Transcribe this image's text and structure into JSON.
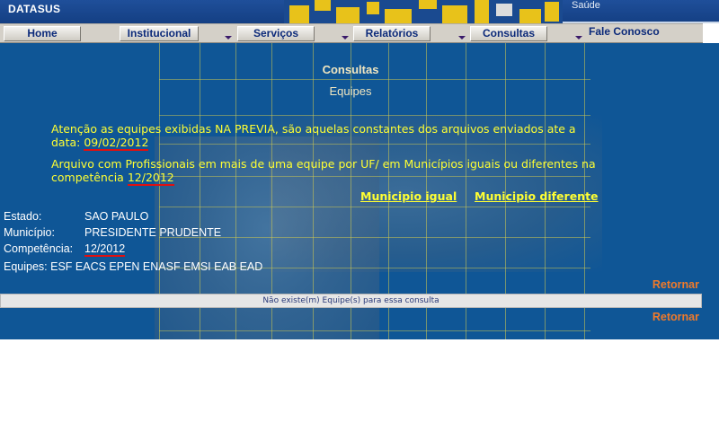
{
  "header": {
    "logo": "DATASUS",
    "ministry": "Saúde"
  },
  "nav": {
    "items": [
      {
        "label": "Home"
      },
      {
        "label": "Institucional"
      },
      {
        "label": "Serviços"
      },
      {
        "label": "Relatórios"
      },
      {
        "label": "Consultas"
      },
      {
        "label": "Fale Conosco"
      }
    ]
  },
  "main": {
    "title": "Consultas",
    "subtitle": "Equipes",
    "notice1_text": "Atenção as equipes exibidas NA PREVIA, são aquelas constantes dos arquivos enviados ate a data:",
    "notice1_date": "09/02/2012",
    "notice2_text": "Arquivo com Profissionais em mais de uma equipe por UF/ em Municípios iguais ou diferentes na competência",
    "notice2_comp": "12/2012",
    "link_igual": "Municipio igual",
    "link_diferente": "Municipio diferente",
    "estado_label": "Estado:",
    "estado_value": "SAO PAULO",
    "municipio_label": "Município:",
    "municipio_value": "PRESIDENTE PRUDENTE",
    "competencia_label": "Competência:",
    "competencia_value": "12/2012",
    "equipes_line": "Equipes: ESF EACS EPEN ENASF EMSI EAB EAD",
    "retornar": "Retornar",
    "empty_message": "Não existe(m) Equipe(s) para essa consulta"
  },
  "colors": {
    "background": "#0f5696",
    "notice_text": "#ffff33",
    "link_accent": "#f07a2a",
    "date_underline": "#e01010"
  }
}
